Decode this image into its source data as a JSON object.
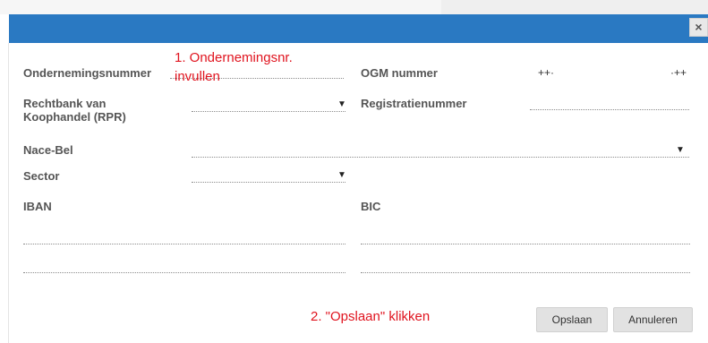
{
  "dialog": {
    "close_symbol": "×"
  },
  "form": {
    "ondernemingsnummer_label": "Ondernemingsnummer",
    "ogm_label": "OGM nummer",
    "ogm_prefix": "++·",
    "ogm_suffix": "·++",
    "rechtbank_label_line1": "Rechtbank van",
    "rechtbank_label_line2": "Koophandel (RPR)",
    "registratienummer_label": "Registratienummer",
    "nacebel_label": "Nace-Bel",
    "sector_label": "Sector",
    "iban_label": "IBAN",
    "bic_label": "BIC",
    "dropdown_caret": "▼"
  },
  "annotations": {
    "step1_line1": "1. Ondernemingsnr.",
    "step1_line2": "invullen",
    "step2": "2. \"Opslaan\" klikken"
  },
  "buttons": {
    "save": "Opslaan",
    "cancel": "Annuleren"
  },
  "colors": {
    "titlebar": "#2a79c2",
    "annotation": "#e0141f"
  }
}
